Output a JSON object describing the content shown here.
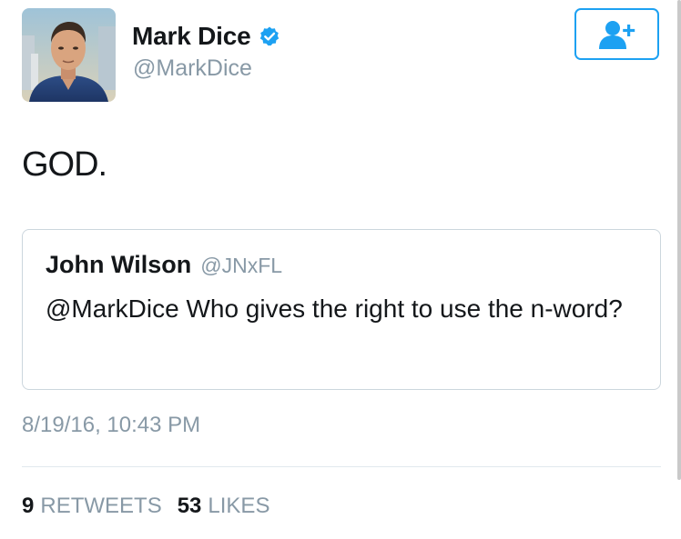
{
  "author": {
    "display_name": "Mark Dice",
    "handle": "@MarkDice",
    "verified": true,
    "avatar_icon": "profile-photo"
  },
  "follow_button": {
    "icon": "add-user-icon",
    "color": "#1da1f2"
  },
  "tweet": {
    "text": "GOD."
  },
  "quoted_tweet": {
    "display_name": "John Wilson",
    "handle": "@JNxFL",
    "text": "@MarkDice Who gives the right to use the n-word?"
  },
  "timestamp": "8/19/16, 10:43 PM",
  "stats": {
    "retweets_count": "9",
    "retweets_label": "RETWEETS",
    "likes_count": "53",
    "likes_label": "LIKES"
  },
  "colors": {
    "accent": "#1da1f2",
    "text_primary": "#14171a",
    "text_secondary": "#8899a6",
    "border": "#ccd6dd"
  }
}
